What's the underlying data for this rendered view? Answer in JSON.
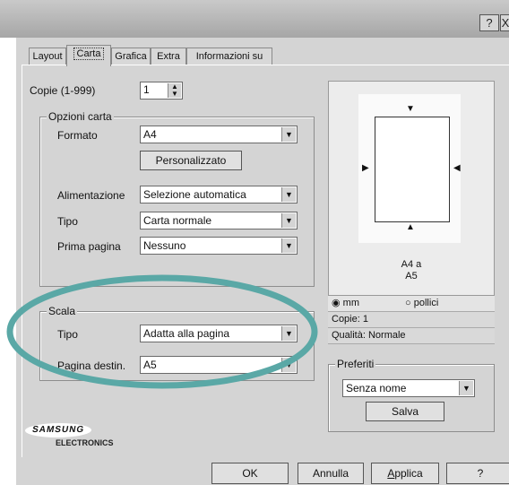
{
  "titlebar": {
    "help_glyph": "?",
    "close_glyph": "X"
  },
  "tabs": [
    {
      "label": "Layout"
    },
    {
      "label": "Carta"
    },
    {
      "label": "Grafica"
    },
    {
      "label": "Extra"
    },
    {
      "label": "Informazioni su"
    }
  ],
  "copies": {
    "label": "Copie (1-999)",
    "value": "1"
  },
  "paper_options": {
    "legend": "Opzioni carta",
    "format_label": "Formato",
    "format_value": "A4",
    "custom_button": "Personalizzato",
    "source_label": "Alimentazione",
    "source_value": "Selezione automatica",
    "type_label": "Tipo",
    "type_value": "Carta normale",
    "first_page_label": "Prima pagina",
    "first_page_value": "Nessuno"
  },
  "scaling": {
    "legend": "Scala",
    "type_label": "Tipo",
    "type_value": "Adatta alla pagina",
    "target_label": "Pagina destin.",
    "target_value": "A5"
  },
  "preview": {
    "caption_line1": "A4 a",
    "caption_line2": "A5",
    "unit_mm": "mm",
    "unit_inch": "pollici",
    "copies_info": "Copie: 1",
    "quality_info": "Qualità: Normale"
  },
  "favorites": {
    "legend": "Preferiti",
    "value": "Senza nome",
    "save_button": "Salva"
  },
  "brand": {
    "name": "SAMSUNG",
    "sub": "ELECTRONICS"
  },
  "footer": {
    "ok": "OK",
    "cancel": "Annulla",
    "apply_prefix": "",
    "apply_underlined": "A",
    "apply_rest": "pplica",
    "help": "?"
  },
  "colors": {
    "highlight_ellipse": "#5aa8a6",
    "dialog_bg": "#d4d4d4"
  }
}
